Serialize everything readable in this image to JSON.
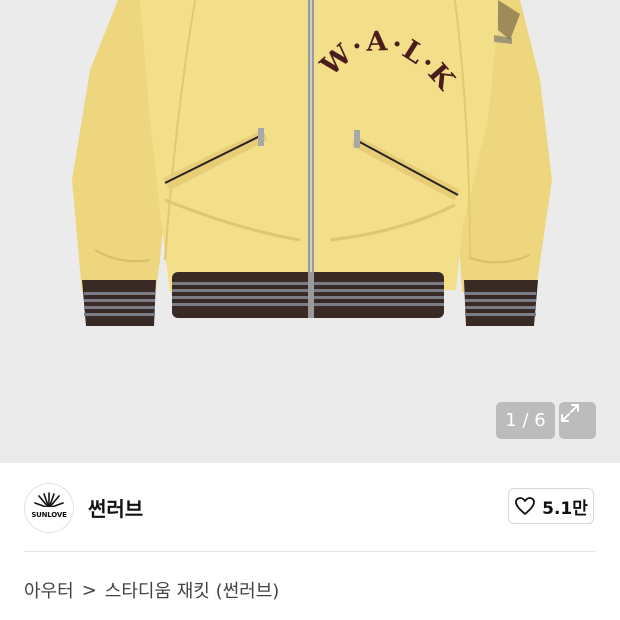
{
  "gallery": {
    "counter_text": "1 / 6",
    "patch_letters": "W·A·L·K",
    "expand_icon": "expand-arrows-icon",
    "background_color": "#ebebec",
    "jacket_color": "#f3de8a"
  },
  "brand": {
    "logo_text": "SUNLOVE",
    "name": "썬러브",
    "like_icon": "heart-icon",
    "like_count": "5.1만"
  },
  "breadcrumb": {
    "category": "아우터",
    "separator": ">",
    "product": "스타디움 재킷 (썬러브)"
  }
}
